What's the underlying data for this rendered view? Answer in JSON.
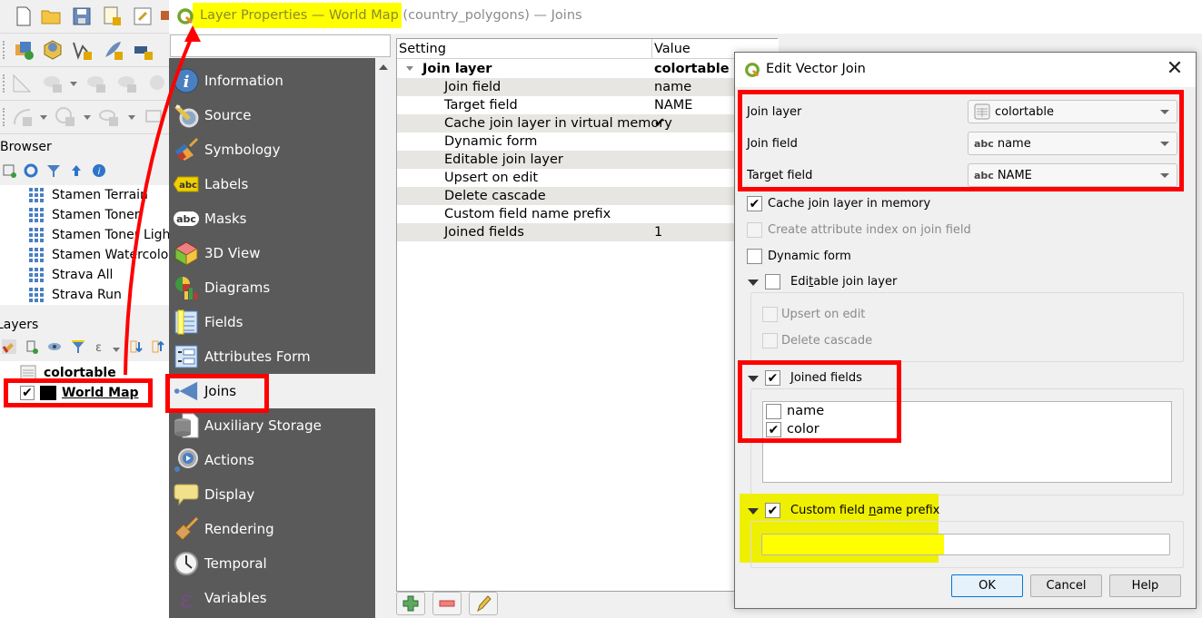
{
  "window": {
    "title_highlighted": "Layer Properties — World Map",
    "title_rest": " (country_polygons) — Joins"
  },
  "browser_panel": {
    "title": "Browser",
    "items": [
      "Stamen Terrain",
      "Stamen Toner",
      "Stamen Toner Light",
      "Stamen Watercolor",
      "Strava All",
      "Strava Run"
    ]
  },
  "layers_panel": {
    "title": "Layers",
    "layers": [
      {
        "name": "colortable",
        "checked": null
      },
      {
        "name": "World Map",
        "checked": true,
        "swatch_color": "#000000"
      }
    ]
  },
  "sidebar": {
    "search_placeholder": "",
    "items": [
      {
        "label": "Information",
        "icon": "info-icon"
      },
      {
        "label": "Source",
        "icon": "source-icon"
      },
      {
        "label": "Symbology",
        "icon": "symbology-icon"
      },
      {
        "label": "Labels",
        "icon": "labels-icon"
      },
      {
        "label": "Masks",
        "icon": "masks-icon"
      },
      {
        "label": "3D View",
        "icon": "3d-view-icon"
      },
      {
        "label": "Diagrams",
        "icon": "diagrams-icon"
      },
      {
        "label": "Fields",
        "icon": "fields-icon"
      },
      {
        "label": "Attributes Form",
        "icon": "attributes-form-icon"
      },
      {
        "label": "Joins",
        "icon": "joins-icon",
        "active": true
      },
      {
        "label": "Auxiliary Storage",
        "icon": "auxiliary-storage-icon"
      },
      {
        "label": "Actions",
        "icon": "actions-icon"
      },
      {
        "label": "Display",
        "icon": "display-icon"
      },
      {
        "label": "Rendering",
        "icon": "rendering-icon"
      },
      {
        "label": "Temporal",
        "icon": "temporal-icon"
      },
      {
        "label": "Variables",
        "icon": "variables-icon"
      }
    ]
  },
  "joins_table": {
    "headers": [
      "Setting",
      "Value"
    ],
    "parent": {
      "setting": "Join layer",
      "value": "colortable"
    },
    "rows": [
      {
        "setting": "Join field",
        "value": "name"
      },
      {
        "setting": "Target field",
        "value": "NAME"
      },
      {
        "setting": "Cache join layer in virtual memory",
        "value": "✔"
      },
      {
        "setting": "Dynamic form",
        "value": ""
      },
      {
        "setting": "Editable join layer",
        "value": ""
      },
      {
        "setting": "Upsert on edit",
        "value": ""
      },
      {
        "setting": "Delete cascade",
        "value": ""
      },
      {
        "setting": "Custom field name prefix",
        "value": ""
      },
      {
        "setting": "Joined fields",
        "value": "1"
      }
    ],
    "buttons": [
      "add-join",
      "remove-join",
      "edit-join"
    ]
  },
  "dialog": {
    "title": "Edit Vector Join",
    "close_glyph": "✕",
    "join_layer_label": "Join layer",
    "join_layer_value": "colortable",
    "join_field_label": "Join field",
    "join_field_value": "name",
    "target_field_label": "Target field",
    "target_field_value": "NAME",
    "field_type_badge": "abc",
    "cache_label": "Cache join layer in memory",
    "cache_checked": true,
    "index_label": "Create attribute index on join field",
    "index_checked": false,
    "dynamic_form_label": "Dynamic form",
    "dynamic_form_checked": false,
    "editable_label_pre": "Edi",
    "editable_label_u": "t",
    "editable_label_post": "able join layer",
    "editable_checked": false,
    "upsert_label": "Upsert on edit",
    "delete_cascade_label": "Delete cascade",
    "joined_fields_label_u": "J",
    "joined_fields_label_post": "oined fields",
    "joined_fields_checked": true,
    "joined_fields": [
      {
        "name": "name",
        "checked": false
      },
      {
        "name": "color",
        "checked": true
      }
    ],
    "prefix_label_pre": "Custom field ",
    "prefix_label_u": "n",
    "prefix_label_post": "ame prefix",
    "prefix_checked": true,
    "prefix_value": "",
    "ok_label": "OK",
    "cancel_label": "Cancel",
    "help_label": "Help",
    "check_glyph": "✔"
  },
  "annotation_colors": {
    "red": "#ff0000",
    "yellow": "#ffff00"
  }
}
